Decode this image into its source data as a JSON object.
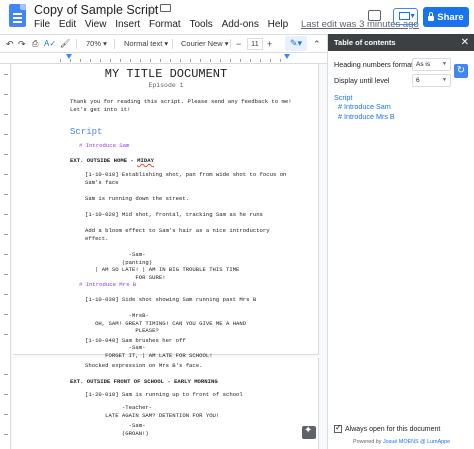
{
  "header": {
    "doc_title": "Copy of Sample Script",
    "menu": [
      "File",
      "Edit",
      "View",
      "Insert",
      "Format",
      "Tools",
      "Add-ons",
      "Help"
    ],
    "last_edit": "Last edit was 3 minutes ago",
    "share_label": "Share"
  },
  "toolbar": {
    "zoom": "70%",
    "style": "Normal text",
    "font": "Courier New",
    "size": "11"
  },
  "document": {
    "title": "MY TITLE DOCUMENT",
    "subtitle": "Episode 1",
    "intro": "Thank you for reading this script. Please send any feedback to me!\nLet's get into it!",
    "heading": "Script",
    "toc_item1": "# Introduce Sam",
    "scene1_a": "EXT. OUTSIDE HOME - ",
    "scene1_b": "MIDAY",
    "shot1": "[1-10-010] Establishing shot, pan from wide shot to focus on\nSam's face",
    "action1": "Sam is running down the street.",
    "shot2": "[1-10-020] Mid shot, frontal, tracking Sam as he runs",
    "action2": "Add a bloom effect to Sam's hair as a nice introductory\neffect.",
    "dialogue1": "             -Sam-\n           (panting)\n   | AM SO LATE! | AM IN BIG TROUBLE THIS TIME\n               FOR SURE!",
    "toc_item2": "# Introduce Mrs B",
    "shot3": "[1-10-030] Side shot showing Sam running past Mrs B",
    "dialogue2": "             -MrsB-\n   OH, SAM! GREAT TIMING! CAN YOU GIVE ME A HAND\n               PLEASE?",
    "shot4": "[1-10-040] Sam brushes her off",
    "dialogue3": "             -Sam-\n      FORGET IT, | AM LATE FOR SCHOOL!",
    "action3": "Shocked expression on Mrs B's face.",
    "scene2": "EXT. OUTSIDE FRONT OF SCHOOL - EARLY MORNING",
    "shot5": "[1-20-010] Sam is running up to front of school",
    "dialogue4": "           -Teacher-\n      LATE AGAIN SAM? DETENTION FOR YOU!",
    "dialogue5": "             -Sam-\n           (GROAN!)"
  },
  "panel": {
    "title": "Table of contents",
    "numbers_label": "Heading numbers format",
    "numbers_value": "As is",
    "level_label": "Display until level",
    "level_value": "6",
    "toc_root": "Script",
    "toc_items": [
      "# Introduce Sam",
      "# Introduce Mrs B"
    ],
    "always_open": "Always open for this document",
    "powered_prefix": "Powered by ",
    "powered_link": "Josué MOENS @ LumAppe"
  }
}
